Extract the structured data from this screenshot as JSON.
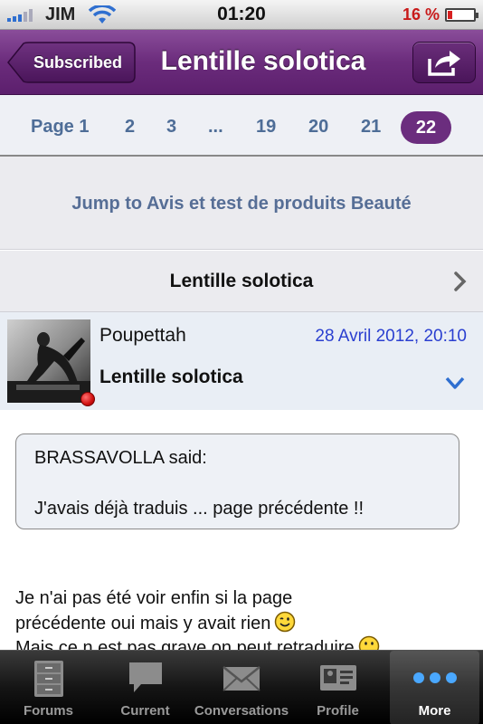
{
  "status_bar": {
    "carrier": "JIM",
    "time": "01:20",
    "battery": "16 %",
    "battery_level": 0.16
  },
  "nav": {
    "back_label": "Subscribed",
    "title": "Lentille solotica",
    "share_icon": "share-icon"
  },
  "pager": {
    "pages": [
      "Page 1",
      "2",
      "3",
      "...",
      "19",
      "20",
      "21"
    ],
    "current": "22"
  },
  "jump": {
    "label": "Jump to Avis et test de produits Beauté"
  },
  "thread": {
    "title": "Lentille solotica"
  },
  "post": {
    "author": "Poupettah",
    "date": "28 Avril 2012, 20:10",
    "subject": "Lentille solotica",
    "online_color": "#d01010",
    "quote": {
      "author": "BRASSAVOLLA said:",
      "text": "J'avais déjà traduis ... page précédente !!"
    },
    "text_line1": "Je n'ai pas été voir enfin si la page",
    "text_line2": "précédente oui mais y avait rien",
    "text_line3": "Mais ce n est pas grave on peut retraduire"
  },
  "tab_bar": {
    "tabs": [
      {
        "label": "Forums",
        "icon": "cabinet-icon"
      },
      {
        "label": "Current",
        "icon": "speech-bubble-icon"
      },
      {
        "label": "Conversations",
        "icon": "envelope-icon"
      },
      {
        "label": "Profile",
        "icon": "id-card-icon"
      },
      {
        "label": "More",
        "icon": "more-dots-icon"
      }
    ],
    "active": "More"
  },
  "colors": {
    "nav_purple": "#6b2c7c",
    "link_blue": "#4e6d97",
    "date_blue": "#2a3fd0"
  }
}
